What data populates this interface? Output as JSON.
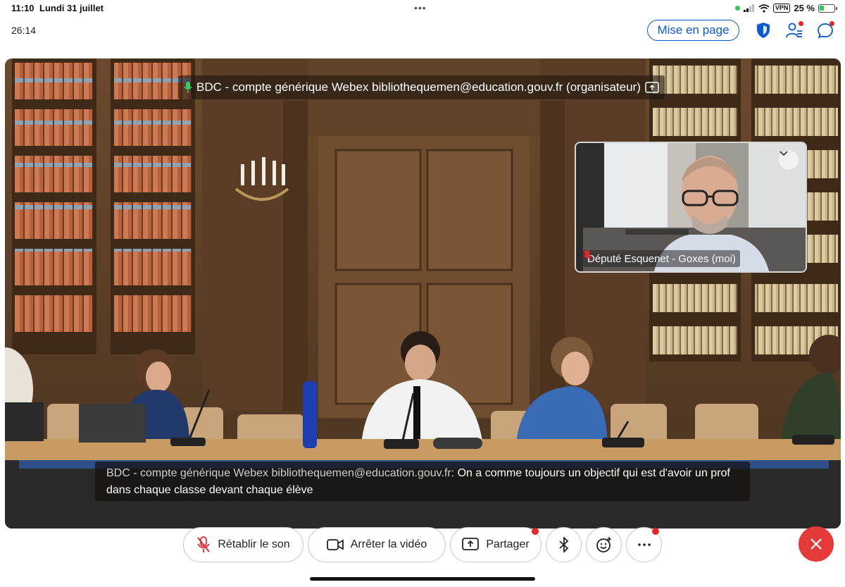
{
  "status_bar": {
    "time": "11:10",
    "date": "Lundi 31 juillet",
    "vpn": "VPN",
    "battery": "25 %",
    "icons": [
      "green-dot",
      "signal-icon",
      "wifi-icon",
      "vpn-badge",
      "battery-icon"
    ]
  },
  "meeting": {
    "elapsed": "26:14",
    "layout_button": "Mise en page",
    "header_icons": [
      "shield-icon",
      "participants-icon",
      "chat-icon"
    ],
    "accent_color": "#0a5ad4"
  },
  "main_video": {
    "speaker_label": "BDC - compte générique Webex bibliothequemen@education.gouv.fr (organisateur)",
    "caption_name": "BDC - compte générique Webex bibliothequemen@education.gouv.fr:",
    "caption_text": "On a comme toujours un objectif qui est d'avoir un prof dans chaque classe devant chaque élève"
  },
  "self_view": {
    "label": "Député Esquenet - Goxes (moi)",
    "muted": true
  },
  "controls": {
    "unmute": "Rétablir le son",
    "stop_video": "Arrêter la vidéo",
    "share": "Partager",
    "end_color": "#e53a3a"
  }
}
